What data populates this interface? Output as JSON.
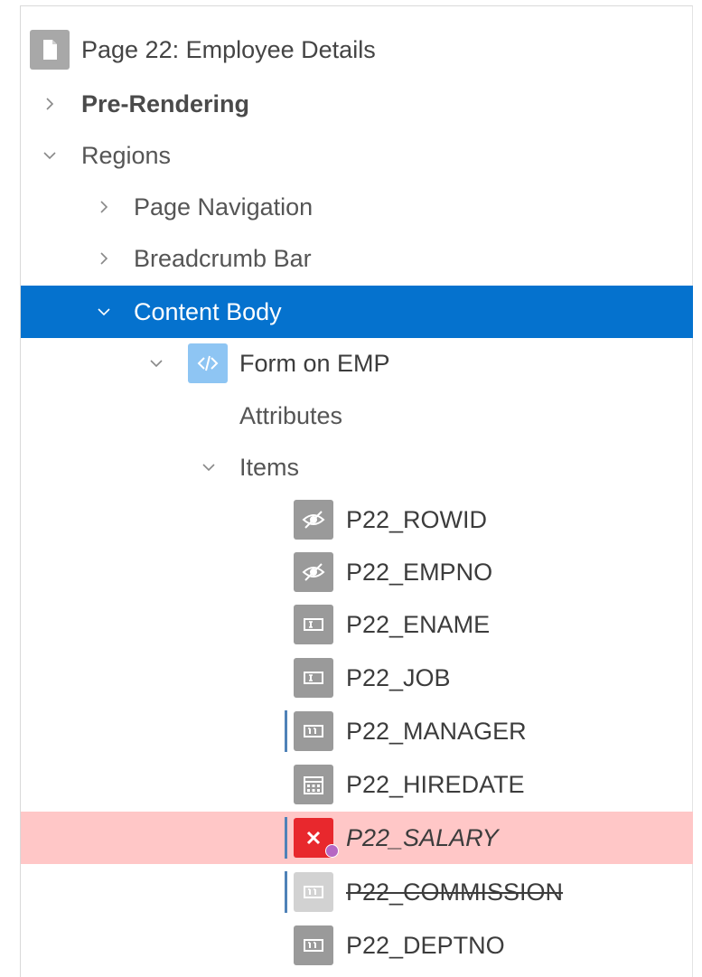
{
  "tree": {
    "page": {
      "label": "Page 22: Employee Details",
      "icon": "page-icon"
    },
    "pre_rendering": {
      "label": "Pre-Rendering"
    },
    "regions": {
      "label": "Regions"
    },
    "page_navigation": {
      "label": "Page Navigation"
    },
    "breadcrumb_bar": {
      "label": "Breadcrumb Bar"
    },
    "content_body": {
      "label": "Content Body"
    },
    "form_on_emp": {
      "label": "Form on EMP",
      "icon": "code-icon"
    },
    "attributes": {
      "label": "Attributes"
    },
    "items": {
      "label": "Items",
      "list": [
        {
          "label": "P22_ROWID",
          "icon": "hidden-eye-icon"
        },
        {
          "label": "P22_EMPNO",
          "icon": "hidden-eye-icon"
        },
        {
          "label": "P22_ENAME",
          "icon": "text-field-icon"
        },
        {
          "label": "P22_JOB",
          "icon": "text-field-icon"
        },
        {
          "label": "P22_MANAGER",
          "icon": "number-field-icon"
        },
        {
          "label": "P22_HIREDATE",
          "icon": "calendar-icon"
        },
        {
          "label": "P22_SALARY",
          "icon": "error-x-icon"
        },
        {
          "label": "P22_COMMISSION",
          "icon": "number-field-icon"
        },
        {
          "label": "P22_DEPTNO",
          "icon": "number-field-icon"
        }
      ]
    }
  },
  "colors": {
    "selected_bg": "#0572ce",
    "error_bg": "#ffc7c7",
    "error_icon": "#e8282d",
    "changed_marker": "#4f82b8",
    "warning_dot": "#b667c3"
  }
}
